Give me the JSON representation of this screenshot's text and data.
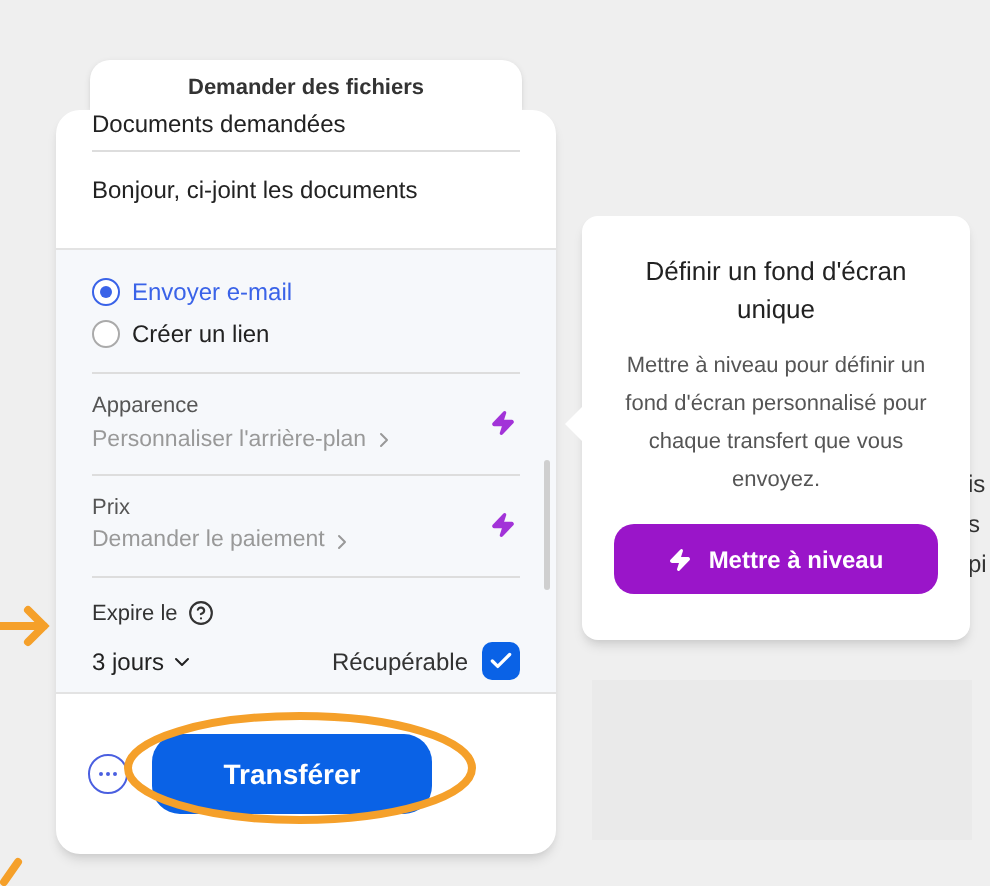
{
  "request_tab": {
    "label": "Demander des fichiers"
  },
  "form": {
    "title_field": {
      "value": "Documents demandées"
    },
    "message_field": {
      "value": "Bonjour, ci-joint les documents"
    },
    "delivery": [
      {
        "label": "Envoyer e-mail",
        "selected": true
      },
      {
        "label": "Créer un lien",
        "selected": false
      }
    ],
    "options": [
      {
        "label": "Apparence",
        "action": "Personnaliser l'arrière-plan",
        "premium": true
      },
      {
        "label": "Prix",
        "action": "Demander le paiement",
        "premium": true
      }
    ],
    "expiry": {
      "label": "Expire le",
      "value": "3 jours"
    },
    "recoverable": {
      "label": "Récupérable",
      "checked": true
    },
    "transfer_button": "Transférer"
  },
  "popover": {
    "title": "Définir un fond d'écran unique",
    "body": "Mettre à niveau pour définir un fond d'écran personnalisé pour chaque transfert que vous envoyez.",
    "button": "Mettre à niveau"
  },
  "background_text": [
    "is",
    "s",
    "pi"
  ]
}
